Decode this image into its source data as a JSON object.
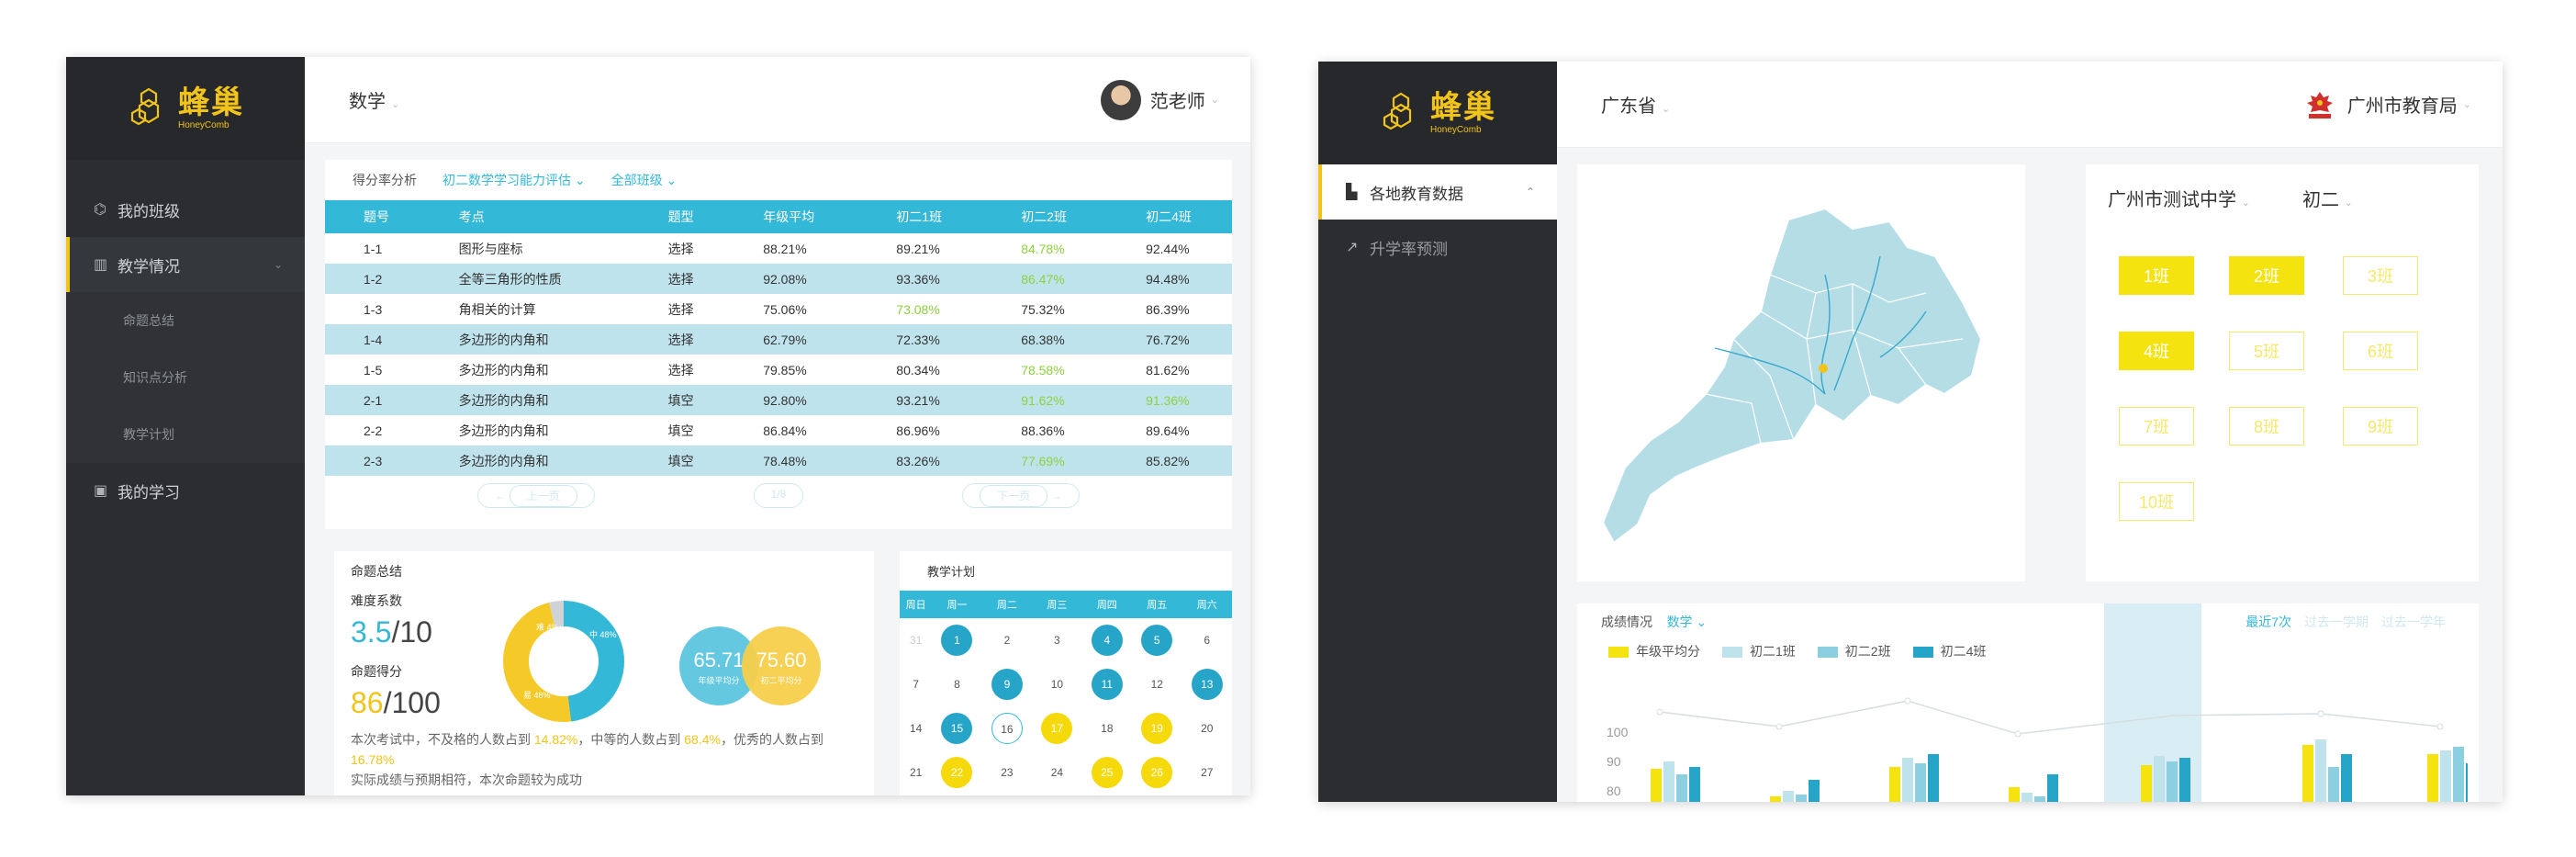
{
  "left": {
    "brand": {
      "cn": "蜂巢",
      "en": "HoneyComb"
    },
    "nav": [
      {
        "label": "我的班级"
      },
      {
        "label": "教学情况"
      },
      {
        "label": "我的学习"
      }
    ],
    "subnav": [
      "命题总结",
      "知识点分析",
      "教学计划"
    ],
    "subject": "数学",
    "user": "范老师",
    "filters": {
      "label": "得分率分析",
      "exam": "初二数学学习能力评估",
      "classes": "全部班级"
    },
    "table": {
      "headers": [
        "题号",
        "考点",
        "题型",
        "年级平均",
        "初二1班",
        "初二2班",
        "初二4班"
      ],
      "rows": [
        [
          "1-1",
          "图形与座标",
          "选择",
          "88.21%",
          "89.21%",
          "84.78%",
          "92.44%"
        ],
        [
          "1-2",
          "全等三角形的性质",
          "选择",
          "92.08%",
          "93.36%",
          "86.47%",
          "94.48%"
        ],
        [
          "1-3",
          "角相关的计算",
          "选择",
          "75.06%",
          "73.08%",
          "75.32%",
          "86.39%"
        ],
        [
          "1-4",
          "多边形的内角和",
          "选择",
          "62.79%",
          "72.33%",
          "68.38%",
          "76.72%"
        ],
        [
          "1-5",
          "多边形的内角和",
          "选择",
          "79.85%",
          "80.34%",
          "78.58%",
          "81.62%"
        ],
        [
          "2-1",
          "多边形的内角和",
          "填空",
          "92.80%",
          "93.21%",
          "91.62%",
          "91.36%"
        ],
        [
          "2-2",
          "多边形的内角和",
          "填空",
          "86.84%",
          "86.96%",
          "88.36%",
          "89.64%"
        ],
        [
          "2-3",
          "多边形的内角和",
          "填空",
          "78.48%",
          "83.26%",
          "77.69%",
          "85.82%"
        ]
      ],
      "pager": {
        "prev": "上一页",
        "page": "1/8",
        "next": "下一页"
      }
    },
    "summary": {
      "title": "命题总结",
      "difficulty_label": "难度系数",
      "difficulty": "3.5",
      "difficulty_total": "/10",
      "score_label": "命题得分",
      "score": "86",
      "score_total": "/100",
      "donut": {
        "a_label": "易 48%",
        "b_label": "中 48%",
        "c_label": "难 4%",
        "a": 48,
        "b": 48,
        "c": 4
      },
      "bubble1": {
        "value": "65.71",
        "label": "年级平均分"
      },
      "bubble2": {
        "value": "75.60",
        "label": "初二平均分"
      },
      "note1_a": "本次考试中，不及格的人数占到 ",
      "note1_p1": "14.82%",
      "note1_b": "，中等的人数占到 ",
      "note1_p2": "68.4%",
      "note1_c": "，优秀的人数占到 ",
      "note1_p3": "16.78%",
      "note2": "实际成绩与预期相符，本次命题较为成功"
    },
    "plan": {
      "title": "教学计划",
      "weekdays": [
        "周日",
        "周一",
        "周二",
        "周三",
        "周四",
        "周五",
        "周六"
      ],
      "weeks": [
        [
          "31",
          "1",
          "2",
          "3",
          "4",
          "5",
          "6"
        ],
        [
          "7",
          "8",
          "9",
          "10",
          "11",
          "12",
          "13"
        ],
        [
          "14",
          "15",
          "16",
          "17",
          "18",
          "19",
          "20"
        ],
        [
          "21",
          "22",
          "23",
          "24",
          "25",
          "26",
          "27"
        ]
      ]
    }
  },
  "right": {
    "brand": {
      "cn": "蜂巢",
      "en": "HoneyComb"
    },
    "nav": [
      "各地教育数据",
      "升学率预测"
    ],
    "region": "广东省",
    "org": "广州市教育局",
    "school": "广州市测试中学",
    "grade": "初二",
    "classes": [
      "1班",
      "2班",
      "3班",
      "4班",
      "5班",
      "6班",
      "7班",
      "8班",
      "9班",
      "10班"
    ],
    "perf": {
      "title": "成绩情况",
      "subject": "数学",
      "ranges": [
        "最近7次",
        "过去一学期",
        "过去一学年"
      ],
      "legend": [
        "年级平均分",
        "初二1班",
        "初二2班",
        "初二4班"
      ],
      "axis_ticks": [
        "100",
        "90",
        "80"
      ]
    }
  },
  "colors": {
    "accent": "#34b8d8",
    "yellow": "#f2c318",
    "sidebar": "#2b2d31",
    "green": "#8cd23d"
  }
}
